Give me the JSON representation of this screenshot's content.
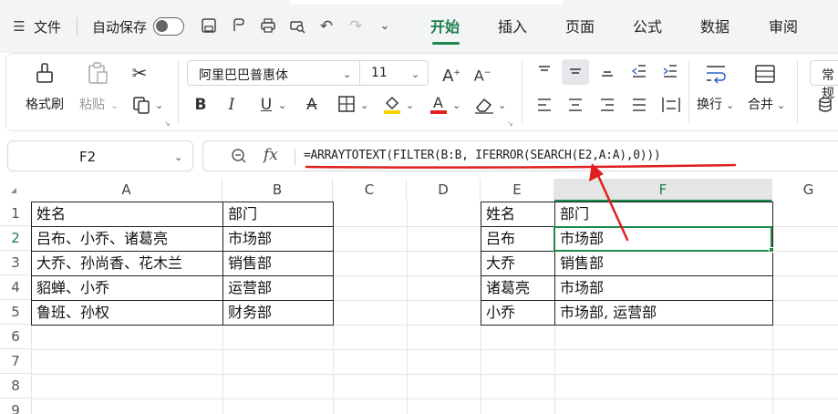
{
  "topbar": {
    "file_label": "文件",
    "autosave_label": "自动保存",
    "tabs": [
      "开始",
      "插入",
      "页面",
      "公式",
      "数据",
      "审阅"
    ],
    "active_tab": "开始"
  },
  "ribbon": {
    "format_painter": "格式刷",
    "paste": "粘贴",
    "font_name": "阿里巴巴普惠体",
    "font_size": "11",
    "wrap": "换行",
    "merge": "合并",
    "style_label": "常规"
  },
  "formula_bar": {
    "name_box": "F2",
    "fx": "fx",
    "formula": "=ARRAYTOTEXT(FILTER(B:B, IFERROR(SEARCH(E2,A:A),0)))"
  },
  "grid": {
    "columns": [
      "A",
      "B",
      "C",
      "D",
      "E",
      "F",
      "G"
    ],
    "active_column": "F",
    "rows": [
      "1",
      "2",
      "3",
      "4",
      "5",
      "6",
      "7",
      "8",
      "9"
    ],
    "active_row": "2",
    "table_left": {
      "header": [
        "姓名",
        "部门"
      ],
      "rows": [
        [
          "吕布、小乔、诸葛亮",
          "市场部"
        ],
        [
          "大乔、孙尚香、花木兰",
          "销售部"
        ],
        [
          "貂蝉、小乔",
          "运营部"
        ],
        [
          "鲁班、孙权",
          "财务部"
        ]
      ]
    },
    "table_right": {
      "header": [
        "姓名",
        "部门"
      ],
      "rows": [
        [
          "吕布",
          "市场部"
        ],
        [
          "大乔",
          "销售部"
        ],
        [
          "诸葛亮",
          "市场部"
        ],
        [
          "小乔",
          "市场部, 运营部"
        ]
      ]
    }
  },
  "colors": {
    "accent": "#1e8a4c",
    "annotation": "#e02020"
  }
}
